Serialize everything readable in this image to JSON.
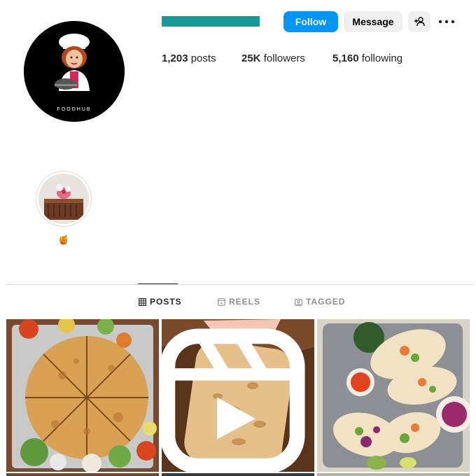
{
  "profile": {
    "avatar_text": "FOODHUB",
    "username_color": "#159a98"
  },
  "actions": {
    "follow_label": "Follow",
    "message_label": "Message",
    "add_user_icon": "person-add-icon",
    "more_icon": "more-horizontal-icon"
  },
  "stats": {
    "posts": {
      "value": "1,203",
      "label": "posts"
    },
    "followers": {
      "value": "25K",
      "label": "followers"
    },
    "following": {
      "value": "5,160",
      "label": "following"
    }
  },
  "highlights": [
    {
      "label": "🍯"
    }
  ],
  "tabs": [
    {
      "label": "POSTS",
      "icon": "grid-icon",
      "active": true
    },
    {
      "label": "REELS",
      "icon": "reels-icon",
      "active": false
    },
    {
      "label": "TAGGED",
      "icon": "tagged-icon",
      "active": false
    }
  ],
  "posts": [
    {
      "type": "image",
      "subject": "quesadilla-platter"
    },
    {
      "type": "reel",
      "subject": "flatbread"
    },
    {
      "type": "image",
      "subject": "tacos"
    }
  ],
  "colors": {
    "accent": "#0095f6",
    "button_secondary": "#efefef",
    "text": "#262626",
    "muted": "#8e8e8e",
    "divider": "#dbdbdb"
  }
}
